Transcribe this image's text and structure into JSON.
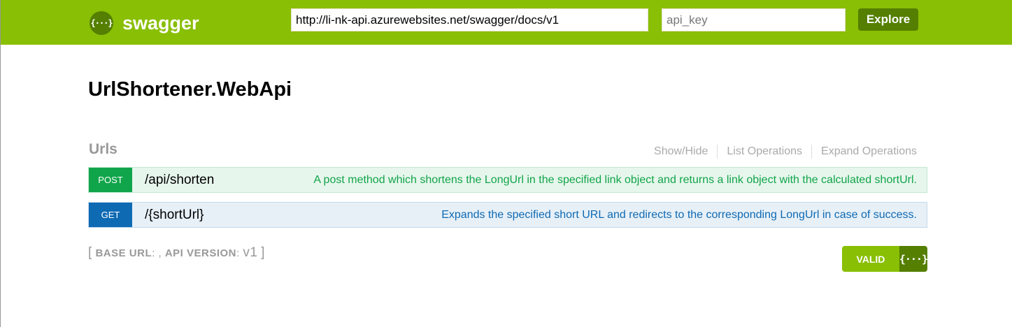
{
  "header": {
    "logo_icon": "{···}",
    "logo_text": "swagger",
    "url_value": "http://li-nk-api.azurewebsites.net/swagger/docs/v1",
    "api_key_placeholder": "api_key",
    "explore_label": "Explore",
    "bg_color": "#89bf04"
  },
  "api": {
    "title": "UrlShortener.WebApi"
  },
  "resource": {
    "name": "Urls",
    "links": [
      "Show/Hide",
      "List Operations",
      "Expand Operations"
    ]
  },
  "operations": [
    {
      "method": "POST",
      "path": "/api/shorten",
      "summary": "A post method which shortens the LongUrl in the specified link object and returns a link object with the calculated shortUrl.",
      "color": "#10a54a"
    },
    {
      "method": "GET",
      "path": "/{shortUrl}",
      "summary": "Expands the specified short URL and redirects to the corresponding LongUrl in case of success.",
      "color": "#0f6ab4"
    }
  ],
  "footer": {
    "open_bracket": "[",
    "base_url_label": "Base url",
    "base_url_value": ": ,",
    "api_version_label": "Api version",
    "api_version_sep": ":",
    "api_version_value": "v1",
    "close_bracket": "]"
  },
  "validator": {
    "label": "VALID",
    "icon": "{···}"
  }
}
